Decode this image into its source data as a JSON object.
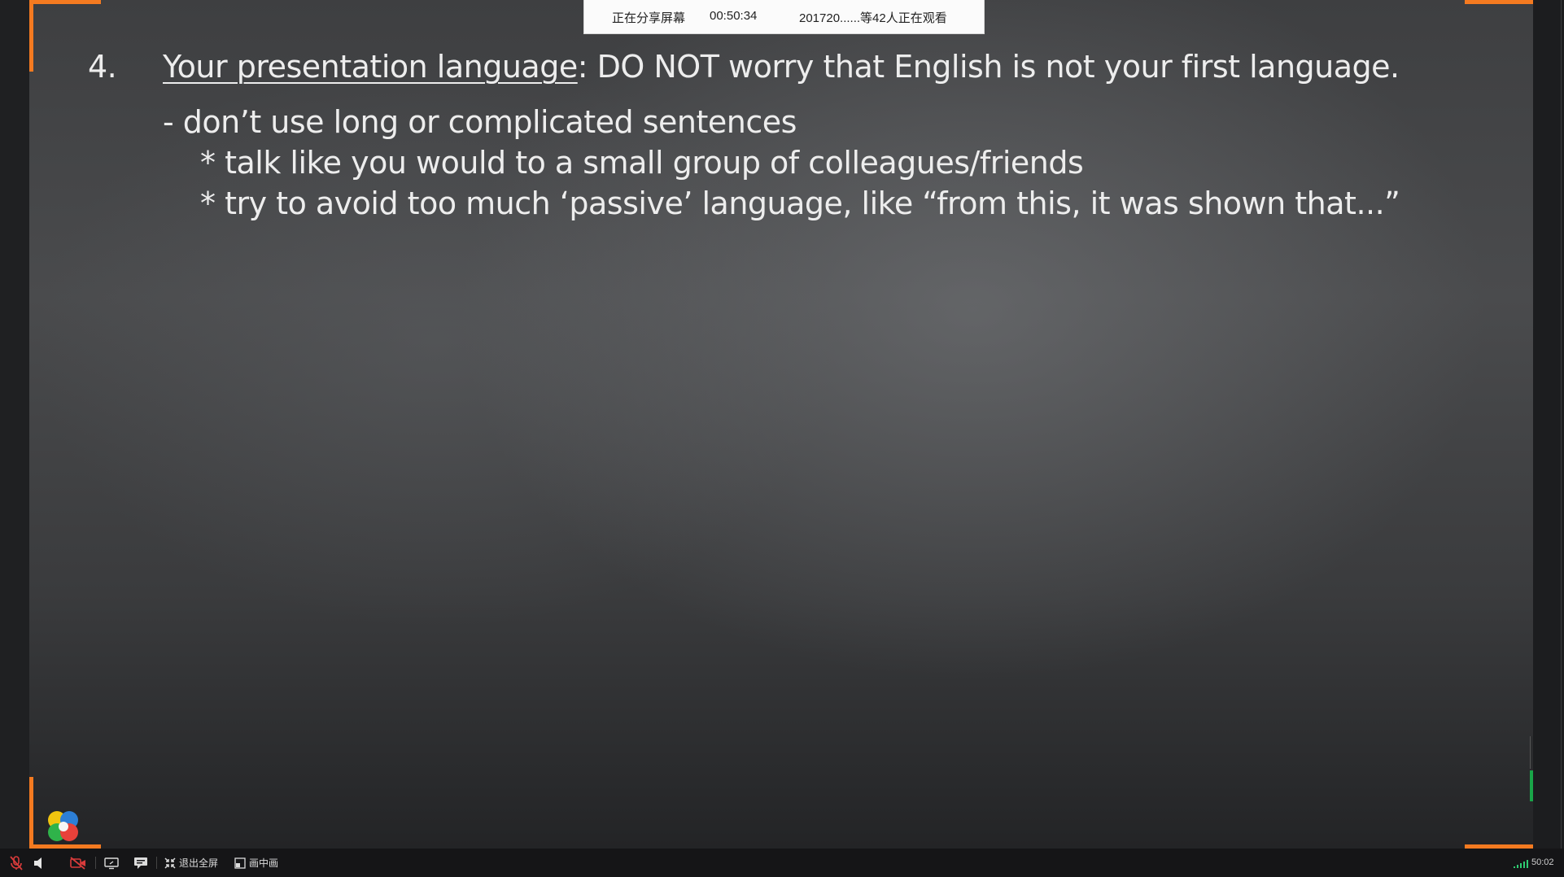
{
  "share_bar": {
    "status": "正在分享屏幕",
    "timer": "00:50:34",
    "viewers": "201720......等42人正在观看"
  },
  "slide": {
    "number": "4.",
    "title_link": "Your presentation language",
    "title_rest": ": DO NOT worry that English is not your first language.",
    "bullet": "- don’t use long or complicated sentences",
    "sub_bullets": [
      "* talk like you would to a small group of colleagues/friends",
      "* try to avoid too much ‘passive’ language, like “from this, it was shown that...”"
    ]
  },
  "toolbar": {
    "exit_fullscreen_label": "退出全屏",
    "pip_label": "画中画",
    "clock": "50:02"
  },
  "colors": {
    "accent_orange": "#f47a20",
    "indicator_green": "#19a548",
    "mute_red": "#d93b3b"
  },
  "icons": [
    "mic-muted-icon",
    "speaker-icon",
    "camera-off-icon",
    "screen-share-icon",
    "chat-icon",
    "exit-fullscreen-icon",
    "pip-icon",
    "signal-icon",
    "app-logo"
  ]
}
